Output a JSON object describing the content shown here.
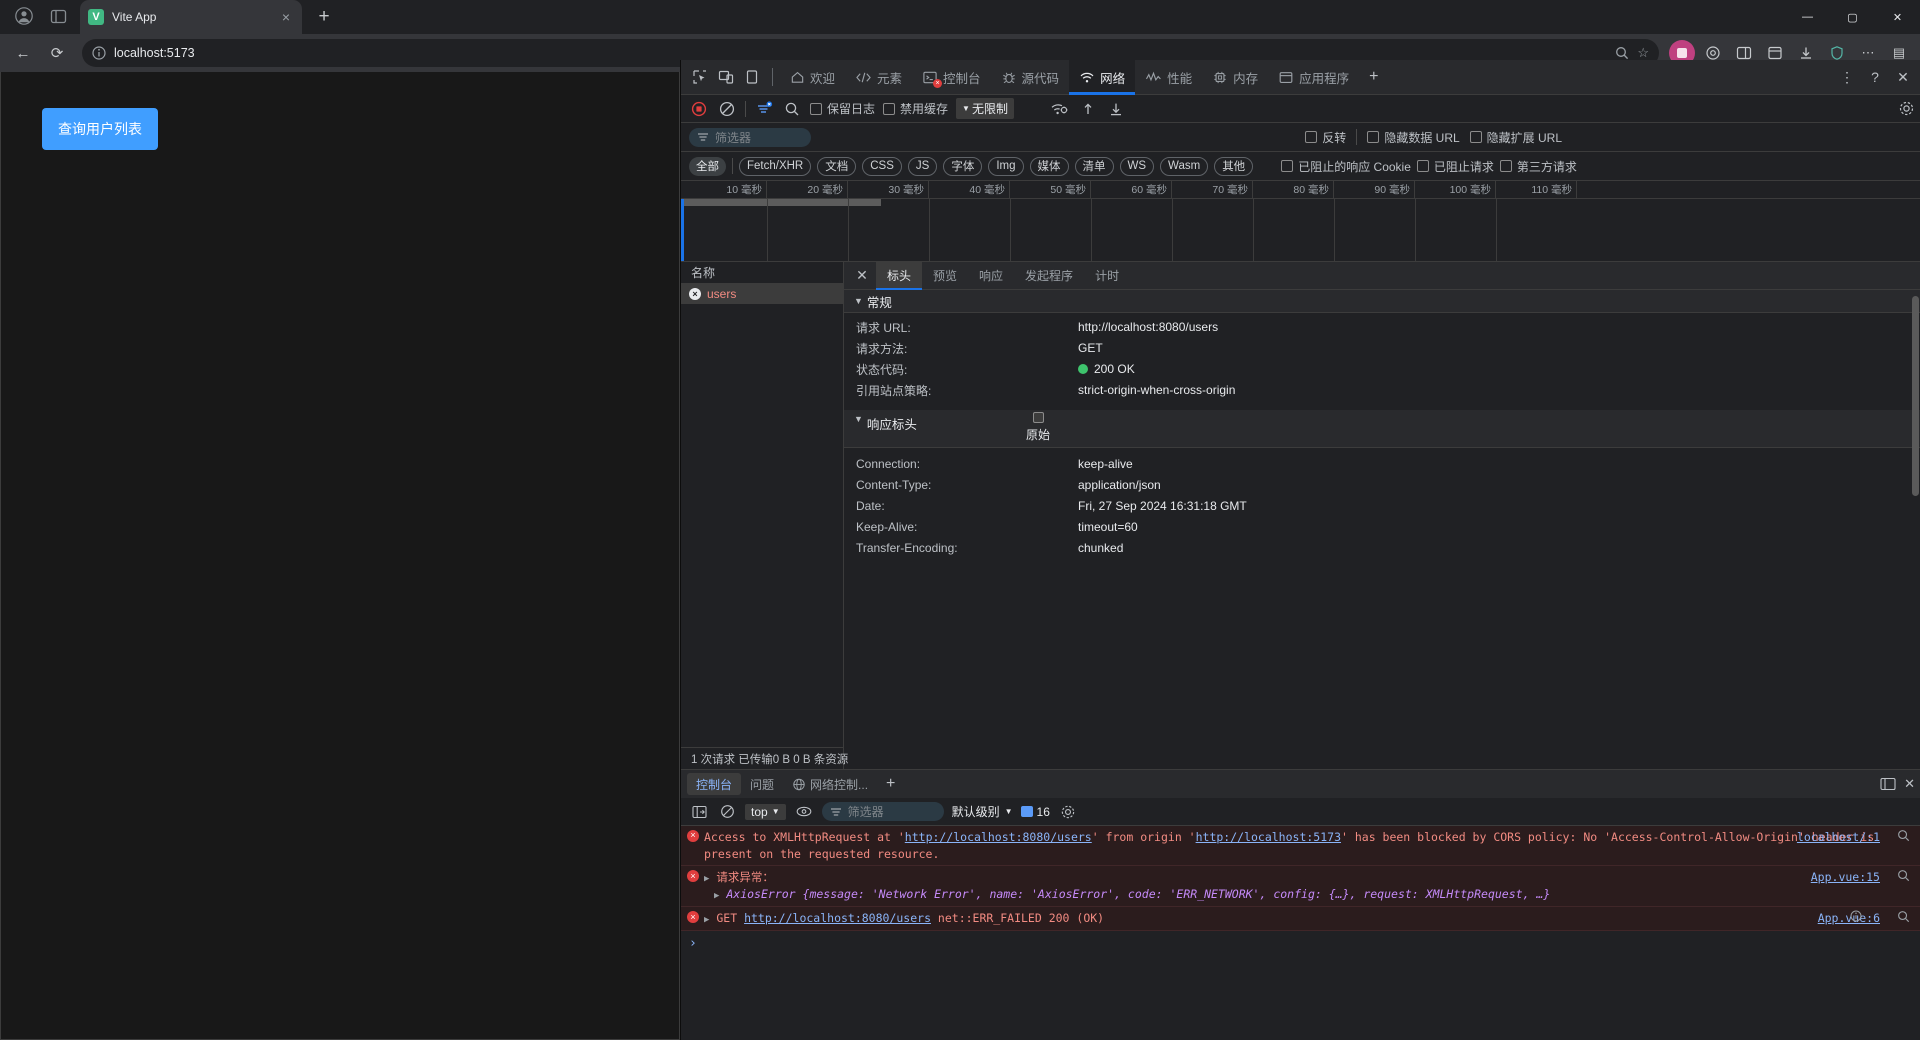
{
  "browser": {
    "tab": {
      "title": "Vite App",
      "favicon_letter": "V",
      "close_icon": "×"
    },
    "new_tab_icon": "+",
    "profile_icon": "profile-avatar",
    "tablist_icon": "tab-list",
    "window_controls": {
      "minimize": "—",
      "maximize": "▢",
      "close": "✕"
    },
    "nav": {
      "back": "←",
      "reload": "⟳"
    },
    "omnibox": {
      "url": "localhost:5173",
      "info_icon": "ⓘ",
      "zoom_icon": "🔍",
      "bookmark_icon": "☆"
    },
    "extensions": [
      "ext-pink",
      "ext-puzzle",
      "ext-split",
      "ext-collections",
      "ext-download",
      "ext-shield"
    ],
    "more_icon": "⋯",
    "sidebar_icon": "▤"
  },
  "page": {
    "button_label": "查询用户列表",
    "button_color": "#409eff"
  },
  "devtools": {
    "device_icons": [
      "inspect-element-icon",
      "device-toolbar-icon",
      "dock-side-icon"
    ],
    "tabs": [
      {
        "label": "欢迎",
        "icon": "home-icon",
        "active": false
      },
      {
        "label": "元素",
        "icon": "code-icon",
        "active": false
      },
      {
        "label": "控制台",
        "icon": "console-icon",
        "active": false,
        "error_badge": true
      },
      {
        "label": "源代码",
        "icon": "bug-icon",
        "active": false
      },
      {
        "label": "网络",
        "icon": "network-icon",
        "active": true
      },
      {
        "label": "性能",
        "icon": "performance-icon",
        "active": false
      },
      {
        "label": "内存",
        "icon": "memory-icon",
        "active": false
      },
      {
        "label": "应用程序",
        "icon": "application-icon",
        "active": false
      }
    ],
    "add_tab_icon": "+",
    "right_icons": {
      "more": "⋮",
      "help": "?",
      "close": "✕"
    },
    "network": {
      "toolbar": {
        "record_icon": "record-stop-icon",
        "clear_icon": "clear-icon",
        "filter_icon": "filter-toggle-icon",
        "search_icon": "search-icon",
        "preserve_log": "保留日志",
        "disable_cache": "禁用缓存",
        "throttle": "无限制",
        "throttle_caret": "▼",
        "wifi_icon": "network-conditions-icon",
        "import_icon": "import-har-icon",
        "export_icon": "export-har-icon",
        "settings_icon": "settings-gear-icon"
      },
      "filter_row": {
        "filter_placeholder": "筛选器",
        "invert": "反转",
        "hide_data_urls": "隐藏数据 URL",
        "hide_ext_urls": "隐藏扩展 URL"
      },
      "types": [
        "全部",
        "Fetch/XHR",
        "文档",
        "CSS",
        "JS",
        "字体",
        "Img",
        "媒体",
        "清单",
        "WS",
        "Wasm",
        "其他"
      ],
      "active_type": "全部",
      "type_checkboxes": [
        "已阻止的响应 Cookie",
        "已阻止请求",
        "第三方请求"
      ],
      "timeline_ticks": [
        "10 毫秒",
        "20 毫秒",
        "30 毫秒",
        "40 毫秒",
        "50 毫秒",
        "60 毫秒",
        "70 毫秒",
        "80 毫秒",
        "90 毫秒",
        "100 毫秒",
        "110 毫秒"
      ],
      "list_header": "名称",
      "rows": [
        {
          "name": "users",
          "error": true
        }
      ],
      "footer": "1 次请求  已传输0 B  0 B 条资源",
      "detail_tabs": [
        "标头",
        "预览",
        "响应",
        "发起程序",
        "计时"
      ],
      "active_detail_tab": "标头",
      "close_icon": "✕",
      "sections": [
        {
          "title": "常规",
          "raw_toggle": null,
          "rows": [
            {
              "key": "请求 URL:",
              "value": "http://localhost:8080/users"
            },
            {
              "key": "请求方法:",
              "value": "GET"
            },
            {
              "key": "状态代码:",
              "value": "200 OK",
              "status": true
            },
            {
              "key": "引用站点策略:",
              "value": "strict-origin-when-cross-origin"
            }
          ]
        },
        {
          "title": "响应标头",
          "raw_toggle": "原始",
          "rows": [
            {
              "key": "Connection:",
              "value": "keep-alive"
            },
            {
              "key": "Content-Type:",
              "value": "application/json"
            },
            {
              "key": "Date:",
              "value": "Fri, 27 Sep 2024 16:31:18 GMT"
            },
            {
              "key": "Keep-Alive:",
              "value": "timeout=60"
            },
            {
              "key": "Transfer-Encoding:",
              "value": "chunked"
            }
          ]
        }
      ]
    },
    "drawer": {
      "tabs": [
        {
          "label": "控制台",
          "active": true
        },
        {
          "label": "问题",
          "active": false
        },
        {
          "label": "网络控制...",
          "icon": "network-conditions-icon",
          "active": false
        }
      ],
      "add_icon": "+",
      "right_icons": [
        "drawer-dock-icon",
        "drawer-close-icon"
      ],
      "toolbar": {
        "sidebar_icon": "console-sidebar-icon",
        "clear_icon": "clear-console-icon",
        "context": "top",
        "context_caret": "▼",
        "eye_icon": "live-expression-icon",
        "filter_placeholder": "筛选器",
        "level": "默认级别",
        "level_caret": "▼",
        "message_count": "16",
        "settings_icon": "console-settings-icon"
      },
      "messages": [
        {
          "type": "error",
          "segments": [
            {
              "t": "Access to XMLHttpRequest at '",
              "link": false
            },
            {
              "t": "http://localhost:8080/users",
              "link": true
            },
            {
              "t": "' from origin '",
              "link": false
            },
            {
              "t": "http://localhost:5173",
              "link": true
            },
            {
              "t": "' has been blocked by CORS policy: No 'Access-Control-Allow-Origin' header is present on the requested resource.",
              "link": false
            }
          ],
          "source": "localhost/:1",
          "search_icon": true
        },
        {
          "type": "error",
          "expandable": true,
          "title": "请求异常：",
          "detail": "AxiosError {message: 'Network Error', name: 'AxiosError', code: 'ERR_NETWORK', config: {…}, request: XMLHttpRequest, …}",
          "source": "App.vue:15",
          "search_icon": true
        },
        {
          "type": "error",
          "expandable": true,
          "prefix": "GET ",
          "link_text": "http://localhost:8080/users",
          "suffix": " net::ERR_FAILED 200 (OK)",
          "source": "App.vue:6",
          "info_icon": true,
          "search_icon": true
        }
      ],
      "prompt_caret": "›"
    }
  }
}
